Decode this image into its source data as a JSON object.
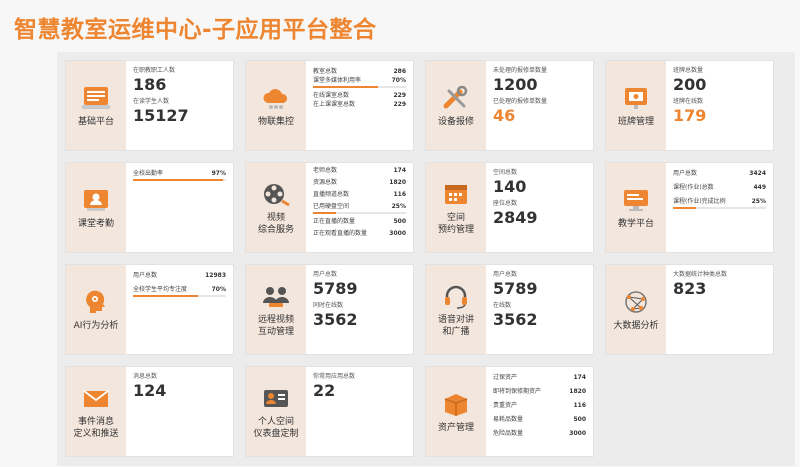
{
  "title": "智慧教室运维中心-子应用平台整合",
  "colors": {
    "accent": "#ee8530",
    "panel": "#f3e6dc"
  },
  "cards": {
    "jichu": {
      "name": "基础平台",
      "icon": "base-platform-icon",
      "l1": "在职教职工人数",
      "v1": "186",
      "l2": "在读学生人数",
      "v2": "15127"
    },
    "wulian": {
      "name": "物联集控",
      "icon": "cloud-control-icon",
      "rows": [
        {
          "label": "教室总数",
          "value": "286"
        },
        {
          "label": "课堂多媒体利用率",
          "value": "70%",
          "progress": 0.7
        },
        {
          "label": "在线课室总数",
          "value": "229"
        },
        {
          "label": "在上课课室总数",
          "value": "229"
        }
      ]
    },
    "baoxiu": {
      "name": "设备报修",
      "icon": "repair-tools-icon",
      "l1": "未处理的报修单数量",
      "v1": "1200",
      "l2": "已处理的报修单数量",
      "v2": "46"
    },
    "banpai": {
      "name": "班牌管理",
      "icon": "class-board-icon",
      "l1": "班牌总数量",
      "v1": "200",
      "l2": "班牌在线数",
      "v2": "179"
    },
    "kaoqin": {
      "name": "课堂考勤",
      "icon": "attendance-icon",
      "rows": [
        {
          "label": "全校出勤率",
          "value": "97%",
          "progress": 0.97
        }
      ]
    },
    "shipin": {
      "name": "视频\n综合服务",
      "icon": "film-reel-icon",
      "rows": [
        {
          "label": "老师总数",
          "value": "174"
        },
        {
          "label": "资源总数",
          "value": "1820"
        },
        {
          "label": "直播频道总数",
          "value": "116"
        },
        {
          "label": "已用硬盘空间",
          "value": "25%",
          "progress": 0.25
        },
        {
          "label": "正在直播的数量",
          "value": "500"
        },
        {
          "label": "正在观看直播的数量",
          "value": "3000"
        }
      ]
    },
    "kongjian": {
      "name": "空间\n预约管理",
      "icon": "calendar-icon",
      "l1": "空间总数",
      "v1": "140",
      "l2": "座位总数",
      "v2": "2849"
    },
    "jiaoxue": {
      "name": "教学平台",
      "icon": "teaching-screen-icon",
      "rows": [
        {
          "label": "用户总数",
          "value": "3424"
        },
        {
          "label": "课程(作业)总数",
          "value": "449"
        },
        {
          "label": "课程(作业)完成比例",
          "value": "25%",
          "progress": 0.25
        }
      ]
    },
    "ai": {
      "name": "AI行为分析",
      "icon": "ai-head-icon",
      "rows": [
        {
          "label": "用户总数",
          "value": "12983"
        },
        {
          "label": "全校学生平均专注度",
          "value": "70%",
          "progress": 0.7
        }
      ]
    },
    "yuancheng": {
      "name": "远程视频\n互动管理",
      "icon": "video-meeting-icon",
      "l1": "用户总数",
      "v1": "5789",
      "l2": "同时在线数",
      "v2": "3562"
    },
    "yuyin": {
      "name": "语音对讲\n和广播",
      "icon": "headset-icon",
      "l1": "用户总数",
      "v1": "5789",
      "l2": "在线数",
      "v2": "3562"
    },
    "dashuju": {
      "name": "大数据分析",
      "icon": "network-globe-icon",
      "l1": "大数据统计种类总数",
      "v1": "823"
    },
    "shijian": {
      "name": "事件消息\n定义和推送",
      "icon": "envelope-icon",
      "l1": "消息总数",
      "v1": "124"
    },
    "geren": {
      "name": "个人空间\n仪表盘定制",
      "icon": "profile-card-icon",
      "l1": "你常用应用总数",
      "v1": "22"
    },
    "zichan": {
      "name": "资产管理",
      "icon": "box-icon",
      "rows": [
        {
          "label": "过保资产",
          "value": "174"
        },
        {
          "label": "即将到保修期资产",
          "value": "1820"
        },
        {
          "label": "贵重资产",
          "value": "116"
        },
        {
          "label": "易耗品数量",
          "value": "500"
        },
        {
          "label": "危险品数量",
          "value": "3000"
        }
      ]
    }
  }
}
